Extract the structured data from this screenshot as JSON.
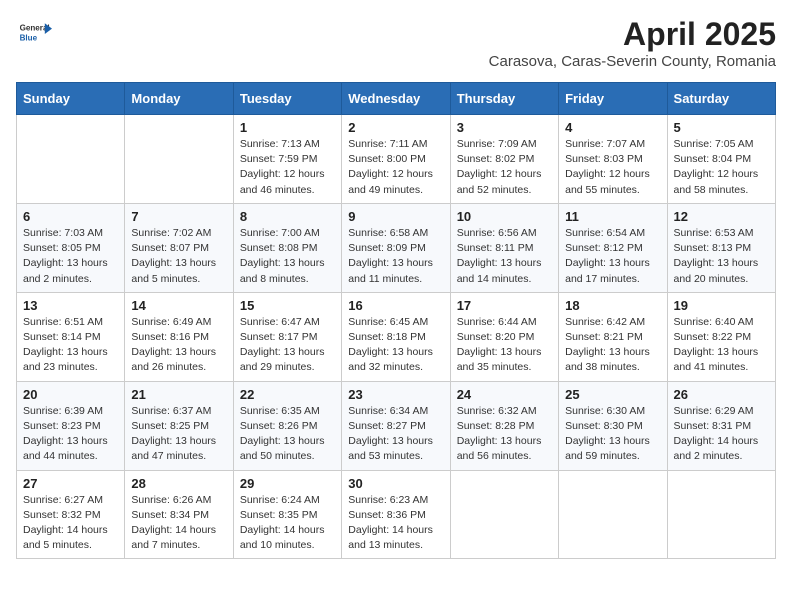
{
  "header": {
    "logo_general": "General",
    "logo_blue": "Blue",
    "month_title": "April 2025",
    "location": "Carasova, Caras-Severin County, Romania"
  },
  "days_of_week": [
    "Sunday",
    "Monday",
    "Tuesday",
    "Wednesday",
    "Thursday",
    "Friday",
    "Saturday"
  ],
  "weeks": [
    [
      {
        "day": "",
        "info": ""
      },
      {
        "day": "",
        "info": ""
      },
      {
        "day": "1",
        "info": "Sunrise: 7:13 AM\nSunset: 7:59 PM\nDaylight: 12 hours and 46 minutes."
      },
      {
        "day": "2",
        "info": "Sunrise: 7:11 AM\nSunset: 8:00 PM\nDaylight: 12 hours and 49 minutes."
      },
      {
        "day": "3",
        "info": "Sunrise: 7:09 AM\nSunset: 8:02 PM\nDaylight: 12 hours and 52 minutes."
      },
      {
        "day": "4",
        "info": "Sunrise: 7:07 AM\nSunset: 8:03 PM\nDaylight: 12 hours and 55 minutes."
      },
      {
        "day": "5",
        "info": "Sunrise: 7:05 AM\nSunset: 8:04 PM\nDaylight: 12 hours and 58 minutes."
      }
    ],
    [
      {
        "day": "6",
        "info": "Sunrise: 7:03 AM\nSunset: 8:05 PM\nDaylight: 13 hours and 2 minutes."
      },
      {
        "day": "7",
        "info": "Sunrise: 7:02 AM\nSunset: 8:07 PM\nDaylight: 13 hours and 5 minutes."
      },
      {
        "day": "8",
        "info": "Sunrise: 7:00 AM\nSunset: 8:08 PM\nDaylight: 13 hours and 8 minutes."
      },
      {
        "day": "9",
        "info": "Sunrise: 6:58 AM\nSunset: 8:09 PM\nDaylight: 13 hours and 11 minutes."
      },
      {
        "day": "10",
        "info": "Sunrise: 6:56 AM\nSunset: 8:11 PM\nDaylight: 13 hours and 14 minutes."
      },
      {
        "day": "11",
        "info": "Sunrise: 6:54 AM\nSunset: 8:12 PM\nDaylight: 13 hours and 17 minutes."
      },
      {
        "day": "12",
        "info": "Sunrise: 6:53 AM\nSunset: 8:13 PM\nDaylight: 13 hours and 20 minutes."
      }
    ],
    [
      {
        "day": "13",
        "info": "Sunrise: 6:51 AM\nSunset: 8:14 PM\nDaylight: 13 hours and 23 minutes."
      },
      {
        "day": "14",
        "info": "Sunrise: 6:49 AM\nSunset: 8:16 PM\nDaylight: 13 hours and 26 minutes."
      },
      {
        "day": "15",
        "info": "Sunrise: 6:47 AM\nSunset: 8:17 PM\nDaylight: 13 hours and 29 minutes."
      },
      {
        "day": "16",
        "info": "Sunrise: 6:45 AM\nSunset: 8:18 PM\nDaylight: 13 hours and 32 minutes."
      },
      {
        "day": "17",
        "info": "Sunrise: 6:44 AM\nSunset: 8:20 PM\nDaylight: 13 hours and 35 minutes."
      },
      {
        "day": "18",
        "info": "Sunrise: 6:42 AM\nSunset: 8:21 PM\nDaylight: 13 hours and 38 minutes."
      },
      {
        "day": "19",
        "info": "Sunrise: 6:40 AM\nSunset: 8:22 PM\nDaylight: 13 hours and 41 minutes."
      }
    ],
    [
      {
        "day": "20",
        "info": "Sunrise: 6:39 AM\nSunset: 8:23 PM\nDaylight: 13 hours and 44 minutes."
      },
      {
        "day": "21",
        "info": "Sunrise: 6:37 AM\nSunset: 8:25 PM\nDaylight: 13 hours and 47 minutes."
      },
      {
        "day": "22",
        "info": "Sunrise: 6:35 AM\nSunset: 8:26 PM\nDaylight: 13 hours and 50 minutes."
      },
      {
        "day": "23",
        "info": "Sunrise: 6:34 AM\nSunset: 8:27 PM\nDaylight: 13 hours and 53 minutes."
      },
      {
        "day": "24",
        "info": "Sunrise: 6:32 AM\nSunset: 8:28 PM\nDaylight: 13 hours and 56 minutes."
      },
      {
        "day": "25",
        "info": "Sunrise: 6:30 AM\nSunset: 8:30 PM\nDaylight: 13 hours and 59 minutes."
      },
      {
        "day": "26",
        "info": "Sunrise: 6:29 AM\nSunset: 8:31 PM\nDaylight: 14 hours and 2 minutes."
      }
    ],
    [
      {
        "day": "27",
        "info": "Sunrise: 6:27 AM\nSunset: 8:32 PM\nDaylight: 14 hours and 5 minutes."
      },
      {
        "day": "28",
        "info": "Sunrise: 6:26 AM\nSunset: 8:34 PM\nDaylight: 14 hours and 7 minutes."
      },
      {
        "day": "29",
        "info": "Sunrise: 6:24 AM\nSunset: 8:35 PM\nDaylight: 14 hours and 10 minutes."
      },
      {
        "day": "30",
        "info": "Sunrise: 6:23 AM\nSunset: 8:36 PM\nDaylight: 14 hours and 13 minutes."
      },
      {
        "day": "",
        "info": ""
      },
      {
        "day": "",
        "info": ""
      },
      {
        "day": "",
        "info": ""
      }
    ]
  ]
}
